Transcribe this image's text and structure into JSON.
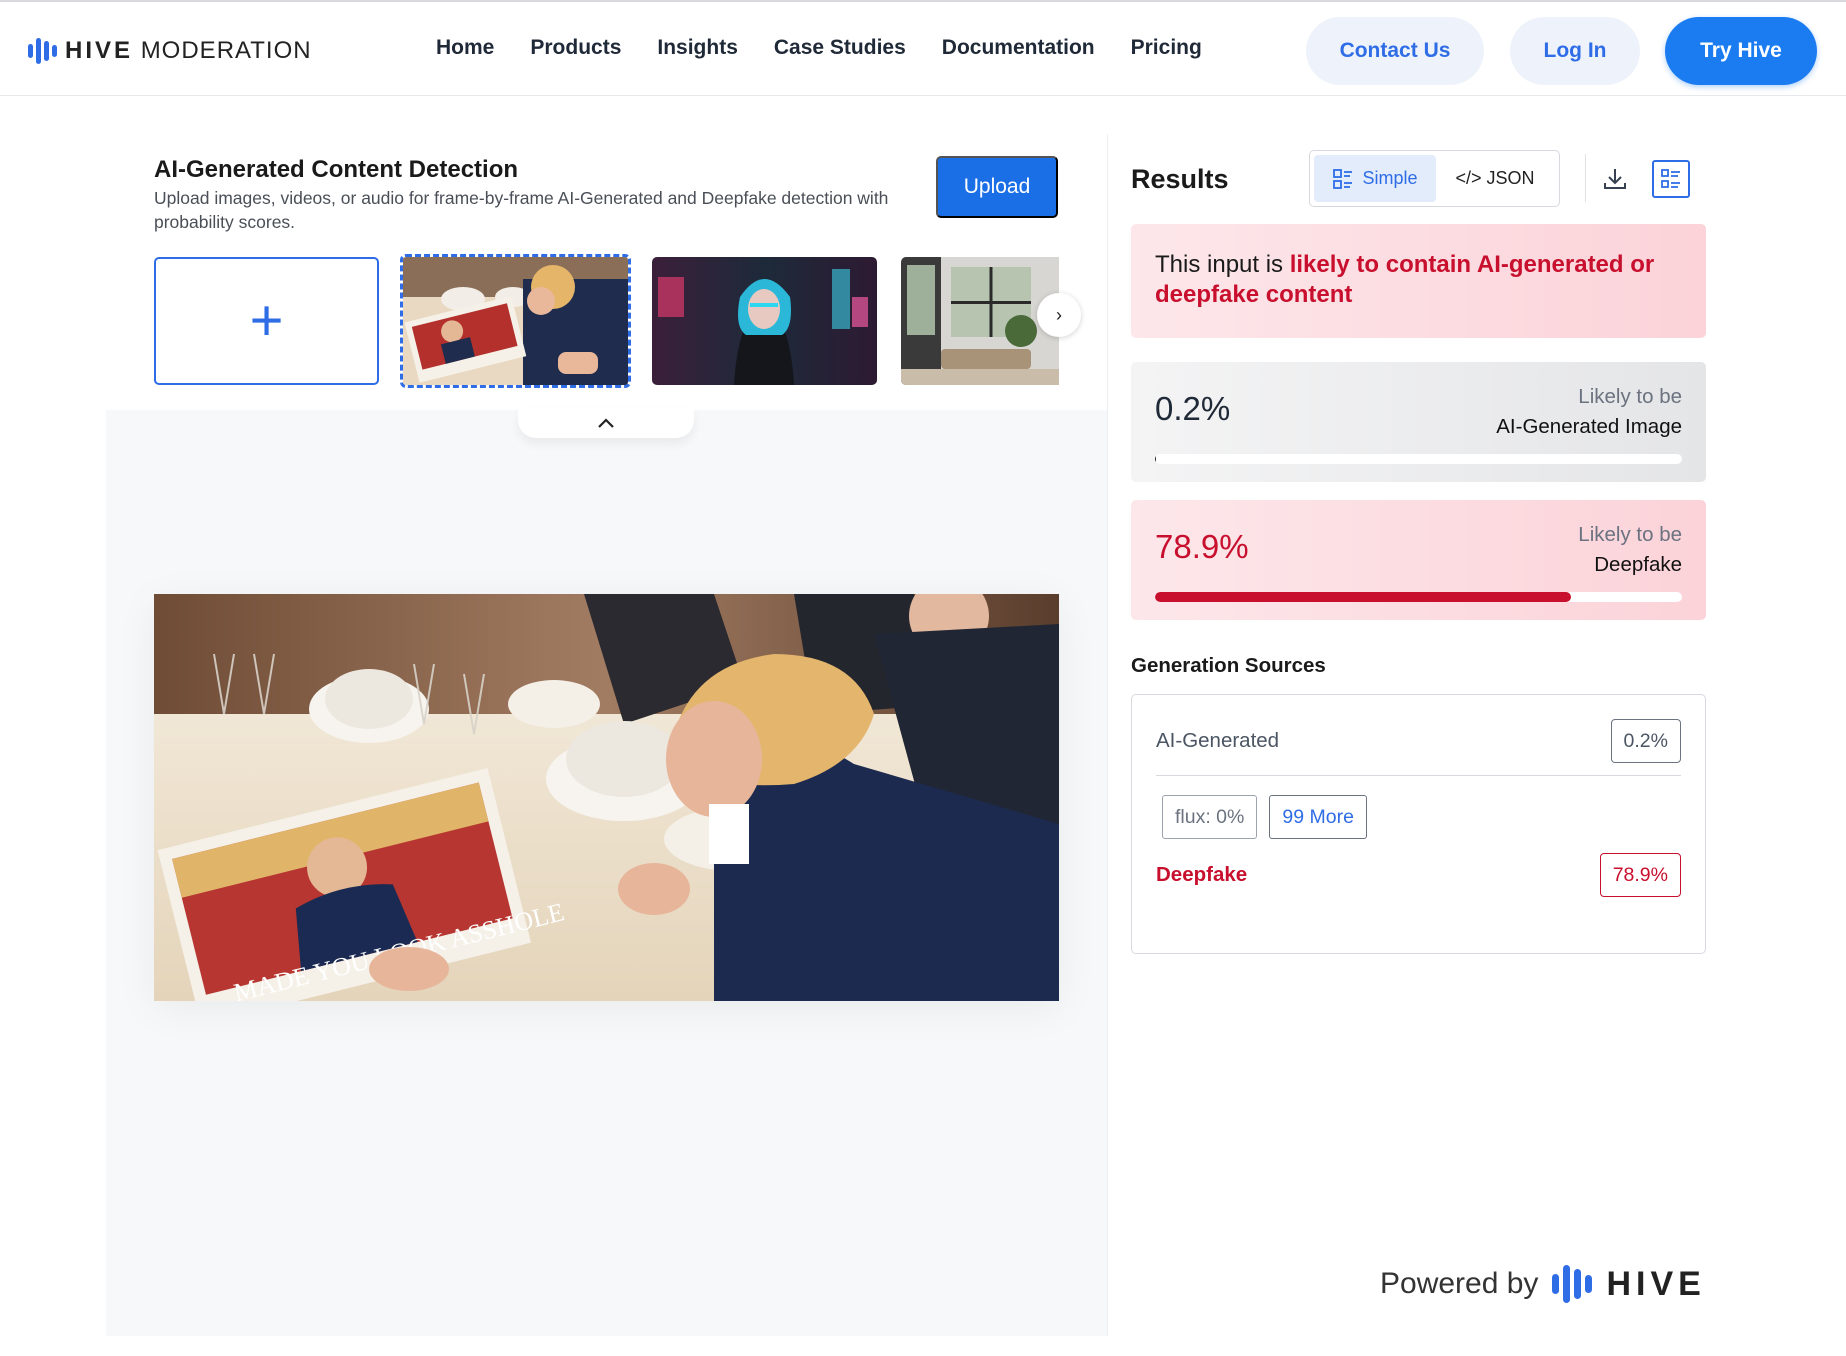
{
  "nav": {
    "brand_bold": "HIVE",
    "brand_light": "MODERATION",
    "links": [
      "Home",
      "Products",
      "Insights",
      "Case Studies",
      "Documentation",
      "Pricing"
    ],
    "contact": "Contact Us",
    "login": "Log In",
    "try": "Try Hive"
  },
  "tool": {
    "title": "AI-Generated Content Detection",
    "subtitle": "Upload images, videos, or audio for frame-by-frame AI-Generated and Deepfake detection with probability scores.",
    "upload_label": "Upload",
    "add_glyph": "+",
    "next_glyph": "›"
  },
  "results": {
    "title": "Results",
    "view_simple": "Simple",
    "view_json": "</> JSON",
    "alert_prefix": "This input is ",
    "alert_highlight": "likely to contain AI-generated or deepfake content",
    "ai_score": {
      "value": "0.2%",
      "fraction": 0.002,
      "label_top": "Likely to be",
      "label_bottom": "AI-Generated Image"
    },
    "deepfake_score": {
      "value": "78.9%",
      "fraction": 0.789,
      "label_top": "Likely to be",
      "label_bottom": "Deepfake"
    },
    "generation_sources_title": "Generation Sources",
    "ai_generated_label": "AI-Generated",
    "ai_generated_value": "0.2%",
    "chip_flux": "flux: 0%",
    "chip_more": "99 More",
    "deepfake_label": "Deepfake",
    "deepfake_value": "78.9%"
  },
  "footer": {
    "powered_by": "Powered by",
    "brand": "HIVE"
  },
  "colors": {
    "accent": "#1a7cf0",
    "alert_red": "#c8102e"
  }
}
